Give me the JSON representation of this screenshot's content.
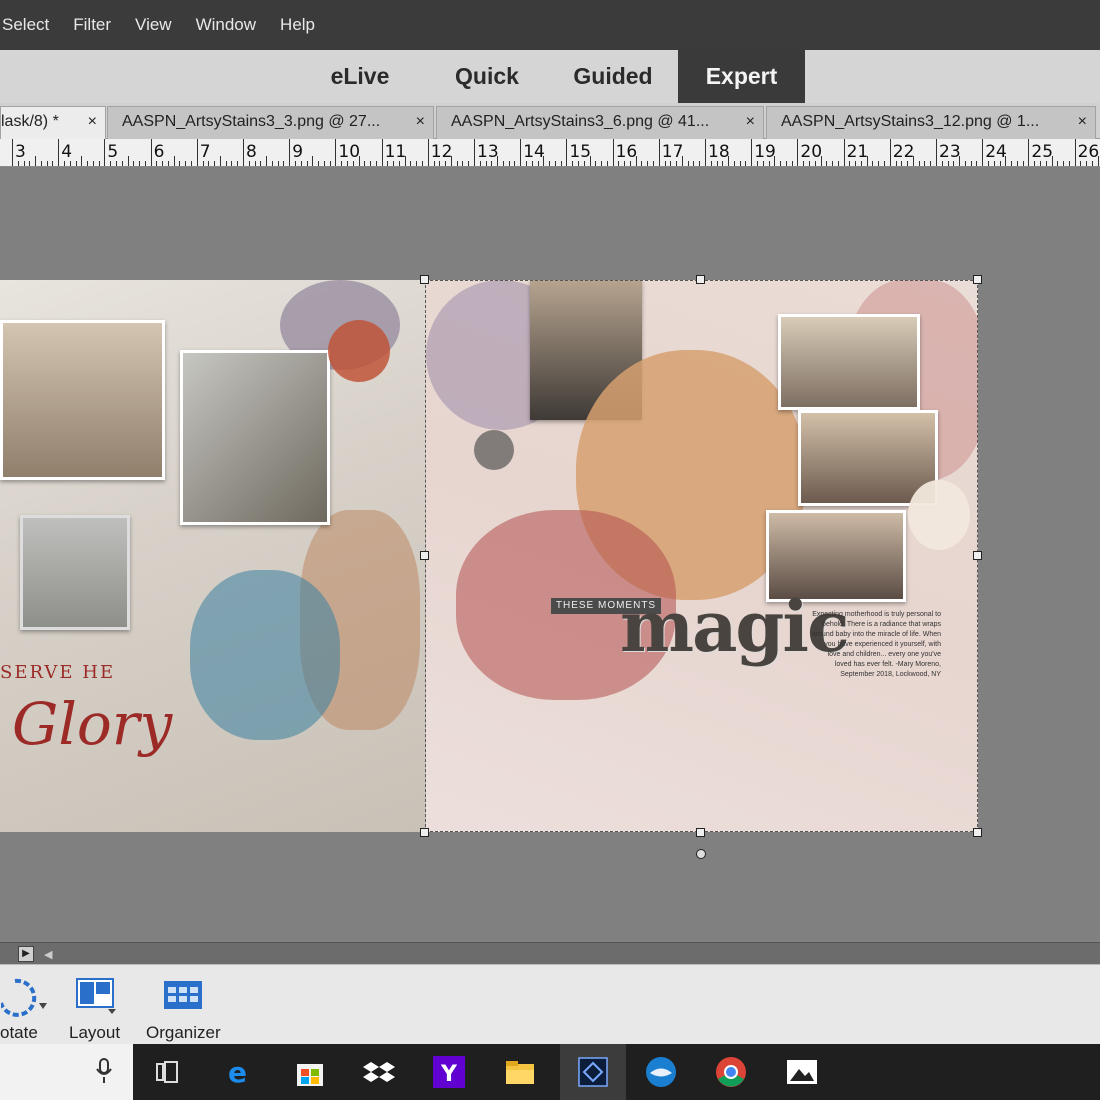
{
  "menubar": {
    "items": [
      "Select",
      "Filter",
      "View",
      "Window",
      "Help"
    ]
  },
  "modes": {
    "tabs": [
      "eLive",
      "Quick",
      "Guided",
      "Expert"
    ],
    "active": "Expert"
  },
  "doc_tabs": [
    {
      "label": "lask/8) *",
      "close": "×"
    },
    {
      "label": "AASPN_ArtsyStains3_3.png @ 27...",
      "close": "×"
    },
    {
      "label": "AASPN_ArtsyStains3_6.png @ 41...",
      "close": "×"
    },
    {
      "label": "AASPN_ArtsyStains3_12.png @ 1...",
      "close": "×"
    }
  ],
  "ruler": {
    "numbers": [
      "3",
      "4",
      "5",
      "6",
      "7",
      "8",
      "9",
      "10",
      "11",
      "12",
      "13",
      "14",
      "15",
      "16",
      "17",
      "18",
      "19",
      "20",
      "21",
      "22",
      "23",
      "24",
      "25",
      "26"
    ]
  },
  "canvas": {
    "left_page": {
      "title_word": "Glory",
      "preserve_text": "SERVE HE"
    },
    "right_page": {
      "banner": "THESE MOMENTS",
      "title_word": "magic",
      "journal": "Expecting motherhood is truly personal to behold. There is a radiance that wraps around baby into the miracle of life. When you have experienced it yourself, with love and children... every one you've loved has ever felt. -Mary Moreno, September 2018, Lockwood, NY",
      "signature": "Lockwood, NY"
    }
  },
  "taskbar": {
    "buttons": [
      {
        "label": "otate",
        "icon": "rotate-icon"
      },
      {
        "label": "Layout",
        "icon": "layout-icon"
      },
      {
        "label": "Organizer",
        "icon": "organizer-icon"
      }
    ]
  },
  "windows_taskbar": {
    "icons": [
      "microphone-icon",
      "task-view-icon",
      "edge-icon",
      "store-icon",
      "dropbox-icon",
      "yahoo-icon",
      "file-explorer-icon",
      "photoshop-elements-icon",
      "thunderbird-icon",
      "chrome-icon",
      "photos-icon"
    ]
  },
  "colors": {
    "menubar_bg": "#3b3b3b",
    "active_mode_bg": "#3a3a3a",
    "workspace_bg": "#808080",
    "title_red": "#9c2a27"
  }
}
